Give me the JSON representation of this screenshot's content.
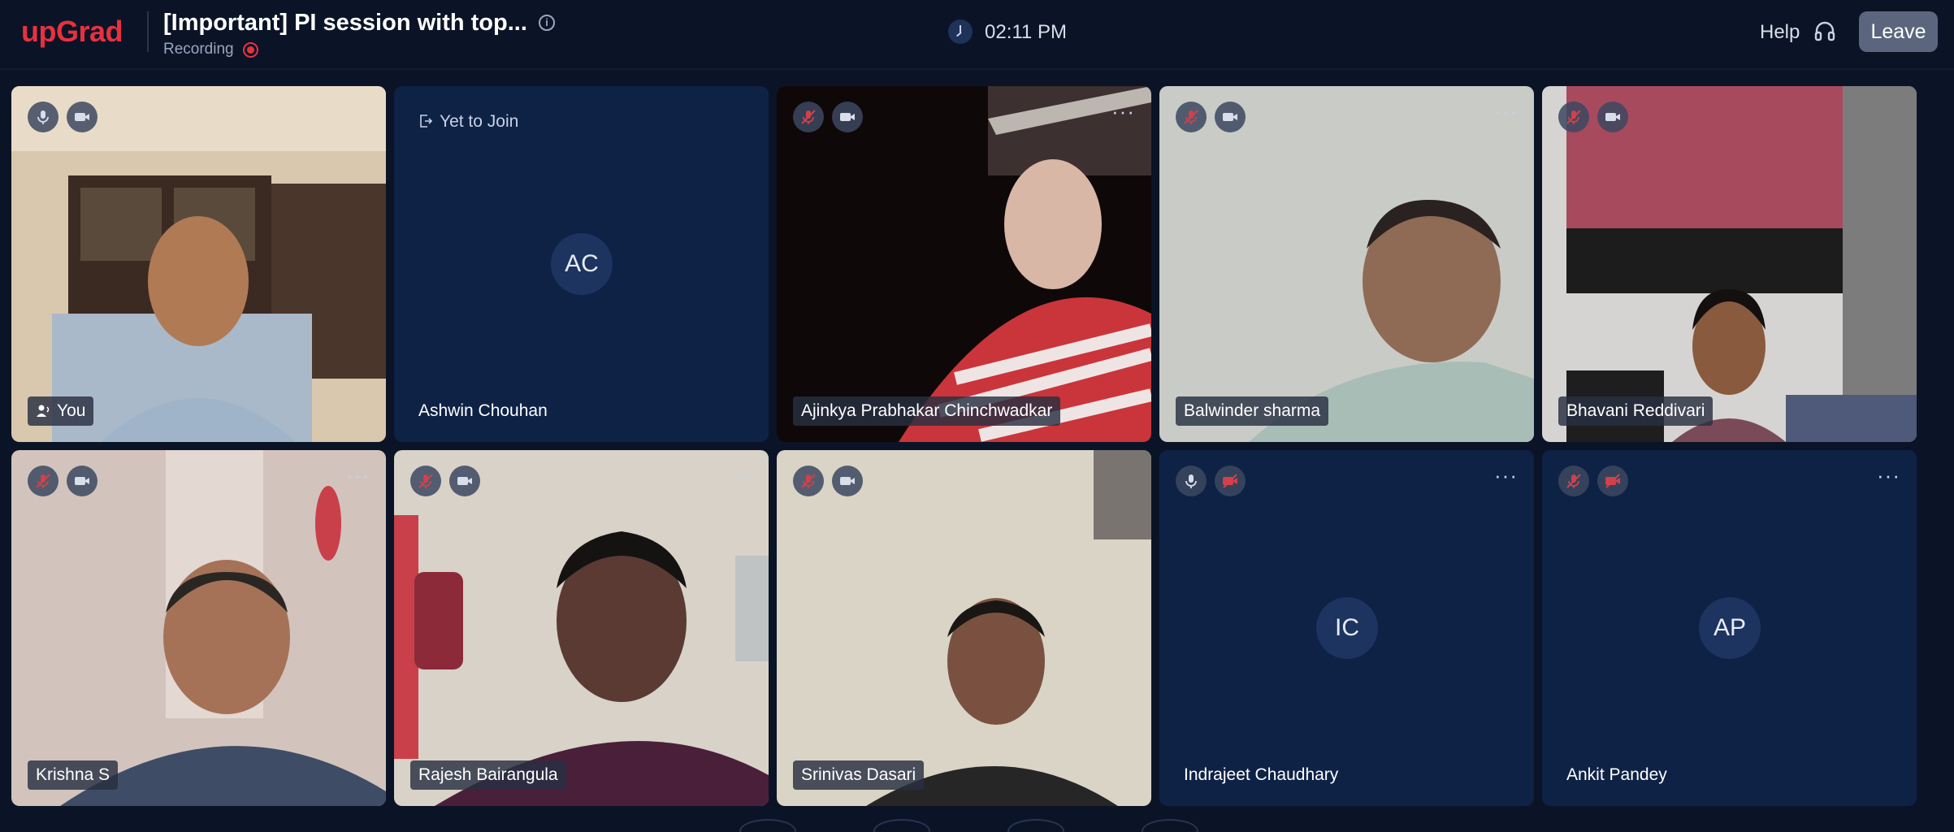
{
  "header": {
    "logo": "upGrad",
    "session_title": "[Important] PI session with top...",
    "recording_label": "Recording",
    "time": "02:11 PM",
    "help_label": "Help",
    "leave_label": "Leave"
  },
  "colors": {
    "brand": "#e8313f",
    "background": "#0b1427",
    "tile_blank": "#0e2246",
    "muted_red": "#d2404a"
  },
  "tiles": [
    {
      "name": "You",
      "state": "video",
      "mic": "on",
      "cam": "on",
      "is_self": true
    },
    {
      "name": "Ashwin Chouhan",
      "state": "yet-to-join",
      "initials": "AC",
      "status": "Yet to Join"
    },
    {
      "name": "Ajinkya Prabhakar Chinchwadkar",
      "state": "video",
      "mic": "muted",
      "cam": "on"
    },
    {
      "name": "Balwinder sharma",
      "state": "video",
      "mic": "muted",
      "cam": "on"
    },
    {
      "name": "Bhavani Reddivari",
      "state": "video",
      "mic": "muted",
      "cam": "on"
    },
    {
      "name": "Krishna S",
      "state": "video",
      "mic": "muted",
      "cam": "on"
    },
    {
      "name": "Rajesh Bairangula",
      "state": "video",
      "mic": "muted",
      "cam": "on"
    },
    {
      "name": "Srinivas Dasari",
      "state": "video",
      "mic": "muted",
      "cam": "on"
    },
    {
      "name": "Indrajeet Chaudhary",
      "state": "no-video",
      "initials": "IC",
      "mic": "on",
      "cam": "off"
    },
    {
      "name": "Ankit Pandey",
      "state": "no-video",
      "initials": "AP",
      "mic": "muted",
      "cam": "off"
    }
  ]
}
